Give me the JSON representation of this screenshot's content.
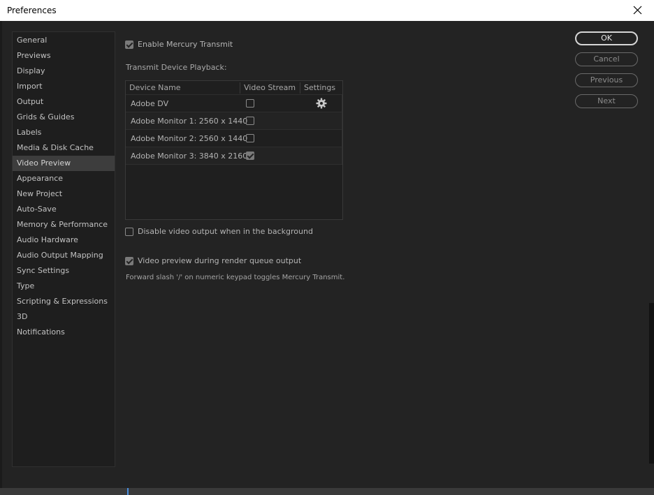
{
  "window": {
    "title": "Preferences"
  },
  "sidebar": {
    "selected": "Video Preview",
    "items": [
      {
        "label": "General"
      },
      {
        "label": "Previews"
      },
      {
        "label": "Display"
      },
      {
        "label": "Import"
      },
      {
        "label": "Output"
      },
      {
        "label": "Grids & Guides"
      },
      {
        "label": "Labels"
      },
      {
        "label": "Media & Disk Cache"
      },
      {
        "label": "Video Preview"
      },
      {
        "label": "Appearance"
      },
      {
        "label": "New Project"
      },
      {
        "label": "Auto-Save"
      },
      {
        "label": "Memory & Performance"
      },
      {
        "label": "Audio Hardware"
      },
      {
        "label": "Audio Output Mapping"
      },
      {
        "label": "Sync Settings"
      },
      {
        "label": "Type"
      },
      {
        "label": "Scripting & Expressions"
      },
      {
        "label": "3D"
      },
      {
        "label": "Notifications"
      }
    ]
  },
  "main": {
    "enable_mercury": {
      "label": "Enable Mercury Transmit",
      "checked": true
    },
    "transmit_heading": "Transmit Device Playback:",
    "table": {
      "headers": {
        "device": "Device Name",
        "stream": "Video Stream",
        "settings": "Settings"
      },
      "rows": [
        {
          "name": "Adobe DV",
          "video_stream": false,
          "has_settings": true,
          "settings_icon": "gear-icon"
        },
        {
          "name": "Adobe Monitor 1: 2560 x 1440",
          "video_stream": false,
          "has_settings": false
        },
        {
          "name": "Adobe Monitor 2: 2560 x 1440",
          "video_stream": false,
          "has_settings": false
        },
        {
          "name": "Adobe Monitor 3: 3840 x 2160",
          "video_stream": true,
          "has_settings": false
        }
      ]
    },
    "disable_background": {
      "label": "Disable video output when in the background",
      "checked": false
    },
    "render_queue_preview": {
      "label": "Video preview during render queue output",
      "checked": true
    },
    "hint": "Forward slash '/' on numeric keypad toggles Mercury Transmit."
  },
  "buttons": {
    "ok": "OK",
    "cancel": "Cancel",
    "previous": "Previous",
    "next": "Next"
  },
  "colors": {
    "background": "#232323",
    "sidebar_bg": "#1e1e1e",
    "selected_bg": "#3d3d3d",
    "text": "#b4b4b4"
  }
}
